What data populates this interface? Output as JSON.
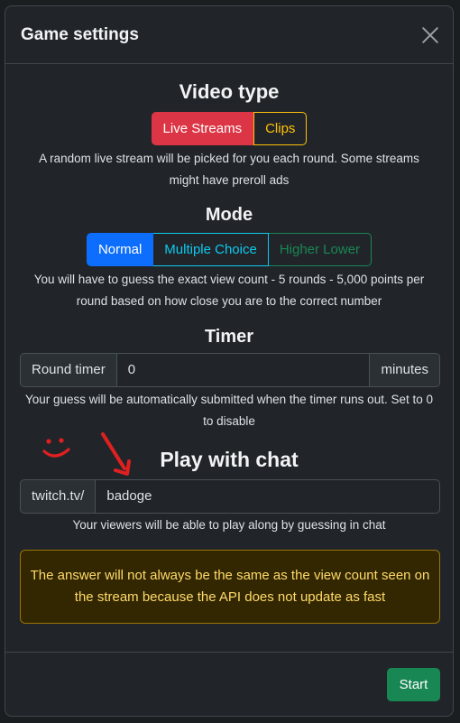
{
  "modal": {
    "title": "Game settings"
  },
  "video_type": {
    "title": "Video type",
    "options": [
      "Live Streams",
      "Clips"
    ],
    "description": "A random live stream will be picked for you each round. Some streams might have preroll ads"
  },
  "mode": {
    "title": "Mode",
    "options": [
      "Normal",
      "Multiple Choice",
      "Higher Lower"
    ],
    "description": "You will have to guess the exact view count - 5 rounds - 5,000 points per round based on how close you are to the correct number"
  },
  "timer": {
    "title": "Timer",
    "label": "Round timer",
    "value": "0",
    "unit": "minutes",
    "description": "Your guess will be automatically submitted when the timer runs out. Set to 0 to disable"
  },
  "chat": {
    "title": "Play with chat",
    "prefix": "twitch.tv/",
    "value": "badoge",
    "description": "Your viewers will be able to play along by guessing in chat"
  },
  "alert": {
    "text": "The answer will not always be the same as the view count seen on the stream because the API does not update as fast"
  },
  "footer": {
    "start_label": "Start"
  },
  "colors": {
    "danger": "#dc3545",
    "warning": "#ffc107",
    "primary": "#0d6efd",
    "info": "#0dcaf0",
    "success": "#198754",
    "annotation": "#e02020"
  },
  "icons": {
    "close": "close-icon",
    "smiley": "smiley-annotation",
    "arrow": "arrow-annotation"
  }
}
